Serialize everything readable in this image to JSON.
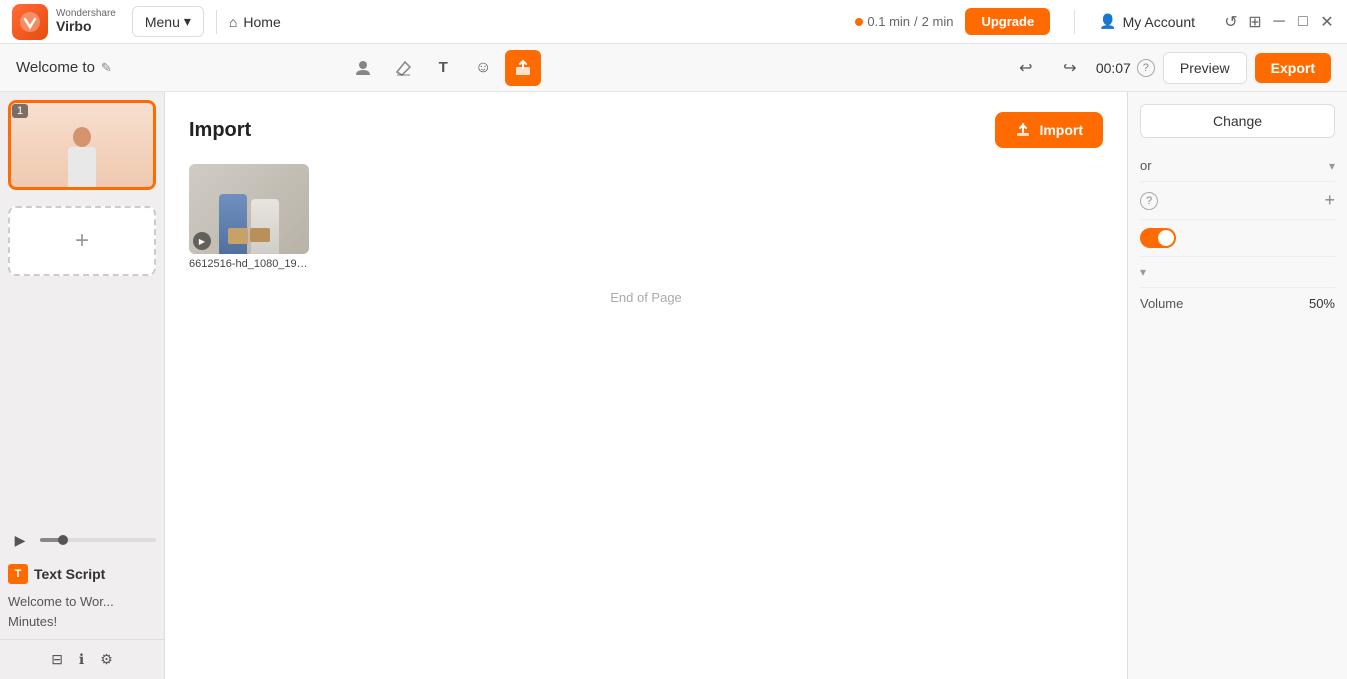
{
  "app": {
    "brand": "Wondershare",
    "product": "Virbo",
    "logo_text": "W"
  },
  "title_bar": {
    "menu_label": "Menu",
    "home_label": "Home",
    "time_used": "0.1 min",
    "time_total": "2 min",
    "upgrade_label": "Upgrade",
    "account_label": "My Account"
  },
  "toolbar": {
    "project_title": "Welcome to",
    "time_display": "00:07",
    "preview_label": "Preview",
    "export_label": "Export",
    "tool_icons": [
      "avatar-tool",
      "eraser-tool",
      "text-tool",
      "emoji-tool",
      "media-tool"
    ]
  },
  "left_panel": {
    "scene_number": "1",
    "add_scene_label": "+",
    "play_button_label": "▶",
    "text_script": {
      "title": "Text Script",
      "content": "Welcome to Wor... Minutes!"
    }
  },
  "import_modal": {
    "title": "Import",
    "import_button_label": "Import",
    "media_items": [
      {
        "name": "6612516-hd_1080_192...",
        "type": "video"
      }
    ],
    "end_of_page_text": "End of Page"
  },
  "right_panel": {
    "change_button_label": "Change",
    "color_label": "or",
    "help_section_label": "?",
    "add_section_label": "+",
    "toggle_state": true,
    "volume_label": "Volume",
    "volume_value": "50%",
    "chevron_icon": "▾"
  }
}
